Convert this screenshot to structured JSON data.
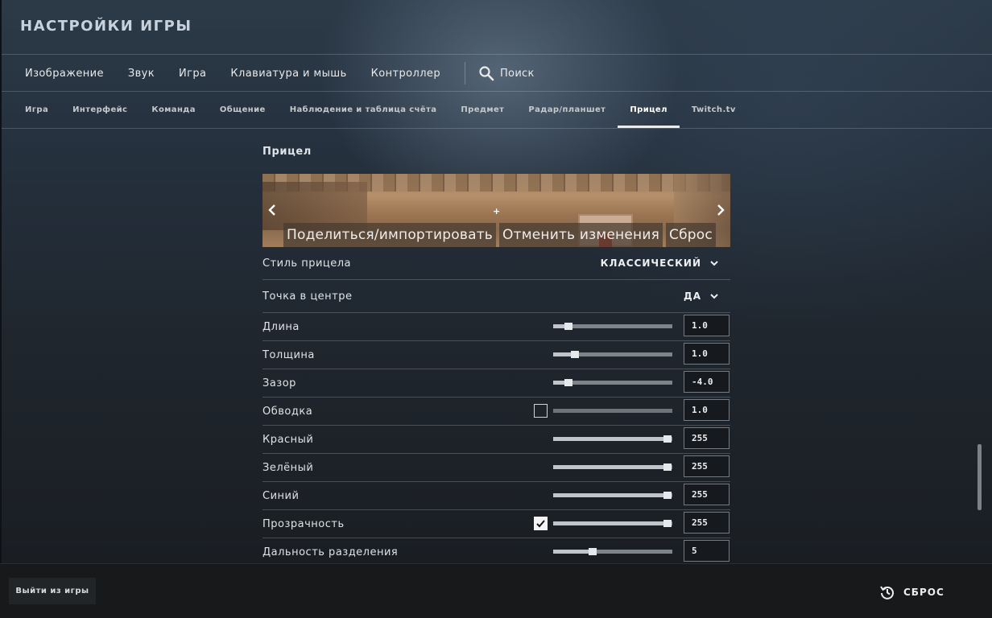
{
  "page": {
    "title": "НАСТРОЙКИ ИГРЫ"
  },
  "main_tabs": [
    {
      "label": "Изображение"
    },
    {
      "label": "Звук"
    },
    {
      "label": "Игра"
    },
    {
      "label": "Клавиатура и мышь"
    },
    {
      "label": "Контроллер"
    }
  ],
  "search": {
    "label": "Поиск",
    "icon": "search-icon"
  },
  "sub_tabs": [
    {
      "label": "Игра"
    },
    {
      "label": "Интерфейс"
    },
    {
      "label": "Команда"
    },
    {
      "label": "Общение"
    },
    {
      "label": "Наблюдение и таблица счёта"
    },
    {
      "label": "Предмет"
    },
    {
      "label": "Радар/планшет"
    },
    {
      "label": "Прицел",
      "active": true
    },
    {
      "label": "Twitch.tv"
    }
  ],
  "section": {
    "title": "Прицел"
  },
  "preview": {
    "share_label": "Поделиться/импортировать",
    "revert_label": "Отменить изменения",
    "reset_label": "Сброс",
    "crosshair_glyph": "+"
  },
  "settings": {
    "style": {
      "label": "Стиль прицела",
      "value": "КЛАССИЧЕСКИЙ"
    },
    "center_dot": {
      "label": "Точка в центре",
      "value": "ДА"
    },
    "length": {
      "label": "Длина",
      "value": "1.0",
      "level": 0.13
    },
    "thickness": {
      "label": "Толщина",
      "value": "1.0",
      "level": 0.18
    },
    "gap": {
      "label": "Зазор",
      "value": "-4.0",
      "level": 0.13
    },
    "outline": {
      "label": "Обводка",
      "value": "1.0",
      "level": 0.0,
      "checked": false
    },
    "red": {
      "label": "Красный",
      "value": "255",
      "level": 0.96
    },
    "green": {
      "label": "Зелёный",
      "value": "255",
      "level": 0.96
    },
    "blue": {
      "label": "Синий",
      "value": "255",
      "level": 0.96
    },
    "alpha": {
      "label": "Прозрачность",
      "value": "255",
      "level": 0.96,
      "checked": true
    },
    "split_distance": {
      "label": "Дальность разделения",
      "value": "5",
      "level": 0.33
    }
  },
  "footer": {
    "exit_label": "Выйти из игры",
    "reset_label": "СБРОС",
    "reset_icon": "history-reset-icon"
  }
}
